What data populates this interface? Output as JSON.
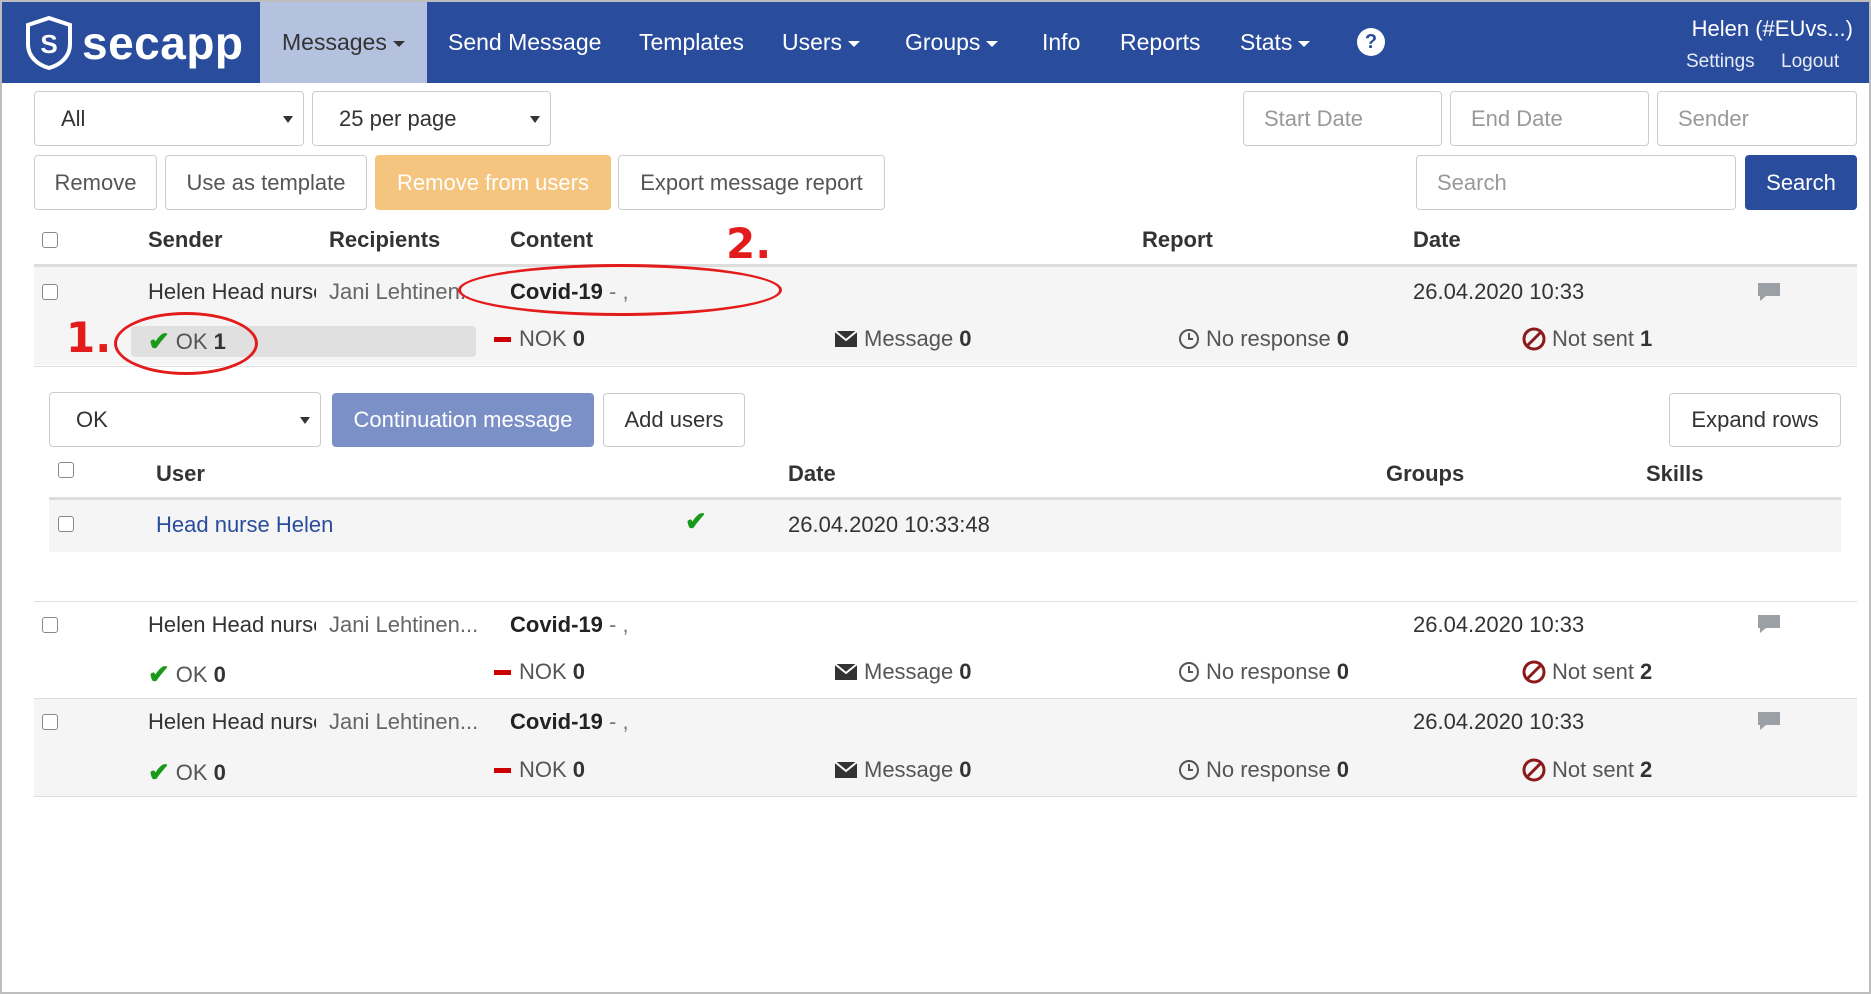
{
  "nav": {
    "brand": "secapp",
    "items": [
      {
        "label": "Messages",
        "dropdown": true,
        "active": true
      },
      {
        "label": "Send Message"
      },
      {
        "label": "Templates"
      },
      {
        "label": "Users",
        "dropdown": true
      },
      {
        "label": "Groups",
        "dropdown": true
      },
      {
        "label": "Info"
      },
      {
        "label": "Reports"
      },
      {
        "label": "Stats",
        "dropdown": true
      }
    ],
    "help": "?",
    "user": "Helen  (#EUvs...)",
    "settings": "Settings",
    "logout": "Logout"
  },
  "filters": {
    "type": "All",
    "per_page": "25 per page",
    "start_date_placeholder": "Start Date",
    "end_date_placeholder": "End Date",
    "sender_placeholder": "Sender",
    "search_placeholder": "Search",
    "search_button": "Search"
  },
  "actions": {
    "remove": "Remove",
    "use_template": "Use as template",
    "remove_from_users": "Remove from users",
    "export_report": "Export message report"
  },
  "table": {
    "headers": {
      "sender": "Sender",
      "recipients": "Recipients",
      "content": "Content",
      "report": "Report",
      "date": "Date"
    },
    "rows": [
      {
        "sender": "Helen Head nurse",
        "recipients": "Jani Lehtinen...",
        "subject": "Covid-19",
        "content_rest": " - ,",
        "date": "26.04.2020 10:33",
        "ok_label": "OK",
        "ok": "1",
        "nok_label": "NOK",
        "nok": "0",
        "message_label": "Message",
        "message": "0",
        "noresp_label": "No response",
        "noresp": "0",
        "notsent_label": "Not sent",
        "notsent": "1"
      },
      {
        "sender": "Helen Head nurse",
        "recipients": "Jani Lehtinen...",
        "subject": "Covid-19",
        "content_rest": " - ,",
        "date": "26.04.2020 10:33",
        "ok_label": "OK",
        "ok": "0",
        "nok_label": "NOK",
        "nok": "0",
        "message_label": "Message",
        "message": "0",
        "noresp_label": "No response",
        "noresp": "0",
        "notsent_label": "Not sent",
        "notsent": "2"
      },
      {
        "sender": "Helen Head nurse",
        "recipients": "Jani Lehtinen...",
        "subject": "Covid-19",
        "content_rest": " - ,",
        "date": "26.04.2020 10:33",
        "ok_label": "OK",
        "ok": "0",
        "nok_label": "NOK",
        "nok": "0",
        "message_label": "Message",
        "message": "0",
        "noresp_label": "No response",
        "noresp": "0",
        "notsent_label": "Not sent",
        "notsent": "2"
      }
    ]
  },
  "detail": {
    "filter": "OK",
    "continuation": "Continuation message",
    "add_users": "Add users",
    "expand_rows": "Expand rows",
    "headers": {
      "user": "User",
      "date": "Date",
      "groups": "Groups",
      "skills": "Skills"
    },
    "rows": [
      {
        "user": "Head nurse Helen",
        "date": "26.04.2020 10:33:48"
      }
    ]
  },
  "annotations": {
    "one": "1.",
    "two": "2."
  },
  "colors": {
    "navbar": "#2a4c9c",
    "accent_orange": "#f5c47f",
    "ok_green": "#1a9a1a",
    "annotation_red": "#e41b1b"
  }
}
